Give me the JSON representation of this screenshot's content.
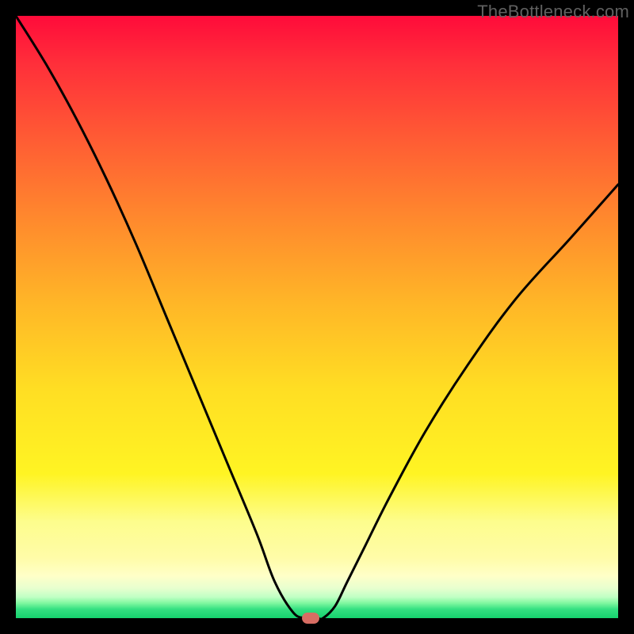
{
  "watermark": "TheBottleneck.com",
  "chart_data": {
    "type": "line",
    "title": "",
    "xlabel": "",
    "ylabel": "",
    "xlim": [
      0,
      100
    ],
    "ylim": [
      0,
      100
    ],
    "grid": false,
    "legend": false,
    "background_gradient": {
      "top": "#ff0b3a",
      "middle": "#ffde23",
      "bottom": "#16d26e"
    },
    "series": [
      {
        "name": "bottleneck-curve",
        "color": "#000000",
        "x": [
          0,
          5,
          10,
          15,
          20,
          25,
          30,
          35,
          40,
          43,
          46,
          48,
          50,
          51,
          53,
          55,
          58,
          62,
          68,
          75,
          83,
          92,
          100
        ],
        "y": [
          100,
          92,
          83,
          73,
          62,
          50,
          38,
          26,
          14,
          6,
          1,
          0,
          0,
          0,
          2,
          6,
          12,
          20,
          31,
          42,
          53,
          63,
          72
        ]
      }
    ],
    "marker": {
      "name": "optimal-point",
      "x": 49,
      "y": 0,
      "color": "#d86d63"
    }
  }
}
